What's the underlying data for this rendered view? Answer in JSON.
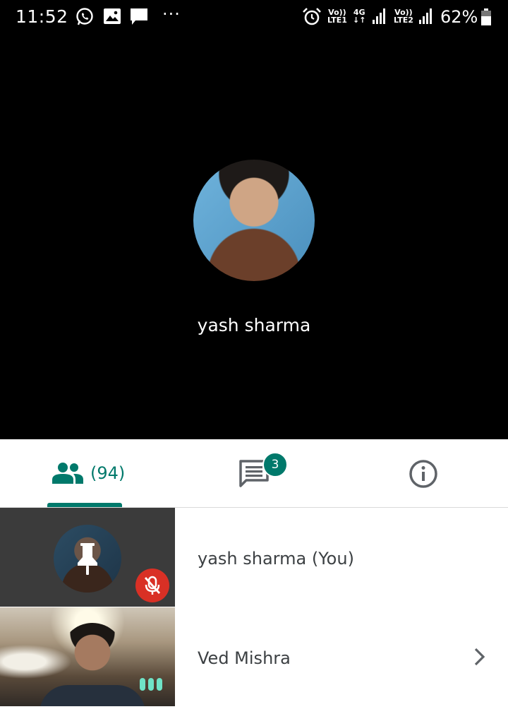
{
  "status_bar": {
    "time": "11:52",
    "notifications": [
      "whatsapp-icon",
      "image-icon",
      "message-icon",
      "more-icon"
    ],
    "sim1": {
      "top": "Vo))",
      "bottom": "LTE1"
    },
    "network": {
      "top": "4G",
      "bottom": "↓↑"
    },
    "sim2": {
      "top": "Vo))",
      "bottom": "LTE2"
    },
    "battery_percent": "62%"
  },
  "stage": {
    "presenter_name": "yash sharma"
  },
  "tabs": {
    "people_count": "(94)",
    "chat_badge": "3",
    "active_tab": "people"
  },
  "participants": [
    {
      "name": "yash sharma (You)",
      "muted": true,
      "pinned_icon": "pin-icon"
    },
    {
      "name": "Ved Mishra",
      "speaking": true
    }
  ],
  "colors": {
    "accent": "#00796b",
    "mute_red": "#d93025",
    "speaking": "#6fe3c7"
  }
}
